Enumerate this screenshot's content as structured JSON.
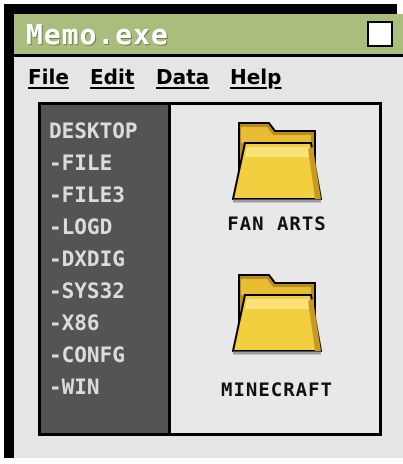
{
  "window": {
    "title": "Memo.exe",
    "accent": "#a9bd7c"
  },
  "menu": [
    {
      "label": "File"
    },
    {
      "label": "Edit"
    },
    {
      "label": "Data"
    },
    {
      "label": "Help"
    }
  ],
  "tree": {
    "items": [
      "DESKTOP",
      "-FILE",
      "-FILE3",
      "-LOGD",
      "-DXDIG",
      "-SYS32",
      "-X86",
      "-CONFG",
      "-WIN"
    ]
  },
  "folders": [
    {
      "label": "FAN ARTS",
      "icon": "folder-icon"
    },
    {
      "label": "MINECRAFT",
      "icon": "folder-icon"
    }
  ],
  "colors": {
    "folder": "#f2cf3e",
    "folder_shadow": "#b88d1e",
    "tree_bg": "#545454"
  }
}
